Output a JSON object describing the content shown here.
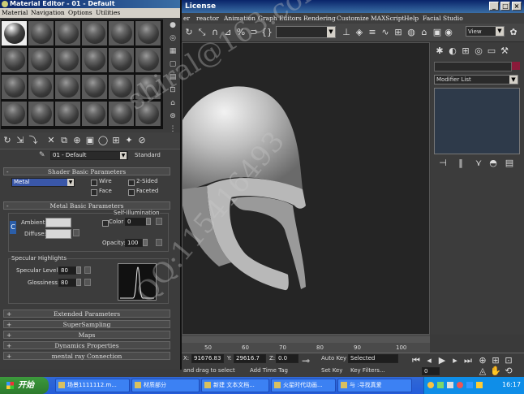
{
  "app": {
    "title": "License",
    "win_min": "_",
    "win_max": "□",
    "win_close": "×",
    "menu": [
      "er",
      "reactor",
      "Animation",
      "Graph Editors",
      "Rendering",
      "Customize",
      "MAXScript",
      "Help",
      "Facial Studio"
    ],
    "view_dropdown": "View",
    "modifier_list": "Modifier List",
    "status_hint": "and drag to select",
    "add_time_tag": "Add Time Tag",
    "coord_x_label": "X:",
    "coord_x": "91676.83",
    "coord_y_label": "Y:",
    "coord_y": "29616.7",
    "coord_z_label": "Z:",
    "coord_z": "0.0",
    "auto_key": "Auto Key",
    "set_key": "Set Key",
    "selected_option": "Selected",
    "key_filters": "Key Filters...",
    "timeline_ticks": [
      "50",
      "60",
      "70",
      "80",
      "90",
      "100"
    ],
    "frame_value": "0"
  },
  "material_editor": {
    "title": "Material Editor - 01 - Default",
    "menu": [
      "Material",
      "Navigation",
      "Options",
      "Utilities"
    ],
    "material_name": "01 - Default",
    "material_type": "Standard",
    "shader_rollout": "Shader Basic Parameters",
    "shader_type": "Metal",
    "wire_label": "Wire",
    "two_sided_label": "2-Sided",
    "face_map_label": "Face",
    "faceted_label": "Faceted",
    "metal_rollout": "Metal Basic Parameters",
    "self_illum_label": "Self-Illumination",
    "color_label": "Color",
    "color_value": "0",
    "ambient_label": "Ambient:",
    "diffuse_label": "Diffuse:",
    "lock_label": "C",
    "opacity_label": "Opacity:",
    "opacity_value": "100",
    "spec_group": "Specular Highlights",
    "spec_level_label": "Specular Level:",
    "spec_level_value": "80",
    "glossiness_label": "Glossiness:",
    "glossiness_value": "80",
    "rollouts": [
      "Extended Parameters",
      "SuperSampling",
      "Maps",
      "Dynamics Properties",
      "mental ray Connection"
    ]
  },
  "taskbar": {
    "start": "开始",
    "tasks": [
      "场景1111112.m...",
      "材质部分",
      "新建 文本文档...",
      "火星时代动画...",
      "与 :寻找真爱"
    ],
    "clock": "16:17"
  },
  "watermark": {
    "line1": "shiral@163.com",
    "line2": "QQ:115416493"
  },
  "colors": {
    "title_bar": "#0a246a",
    "panel_bg": "#3c3c3c",
    "viewport_bg": "#252525",
    "taskbar": "#245dda",
    "start_button": "#2d7a2d"
  }
}
